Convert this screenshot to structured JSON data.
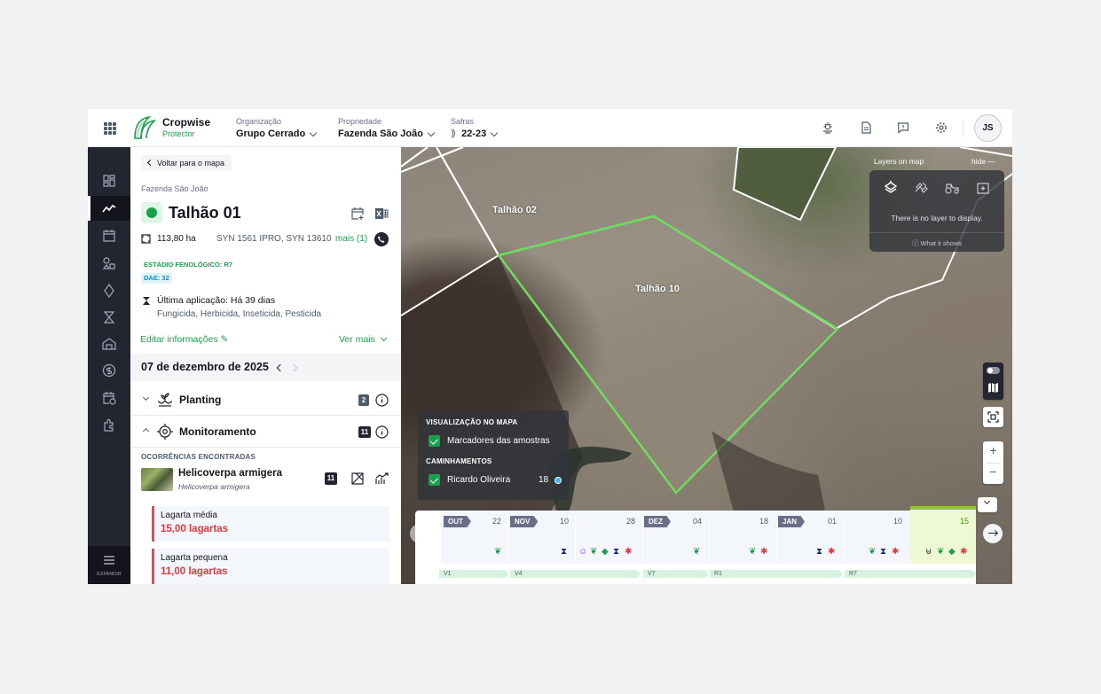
{
  "header": {
    "brand_name": "Cropwise",
    "brand_sub": "Protector",
    "org_label": "Organização",
    "org_value": "Grupo Cerrado",
    "prop_label": "Propriedade",
    "prop_value": "Fazenda São João",
    "safra_label": "Safras",
    "safra_value": "22-23",
    "avatar": "JS"
  },
  "nav": {
    "expand_label": "EXPANDIR"
  },
  "panel": {
    "back_label": "Voltar para o mapa",
    "farm": "Fazenda São João",
    "field_title": "Talhão 01",
    "area": "113,80 ha",
    "varieties": "SYN 1561 IPRO, SYN 13610",
    "more": "mais (1)",
    "stage_tag": "ESTÁDIO FENOLÓGICO: R7",
    "dae_tag": "DAE: 32",
    "last_app": "Última aplicação: Há 39 dias",
    "last_app_types": "Fungicida, Herbicida, Inseticida, Pesticida",
    "edit_label": "Editar informações",
    "see_more": "Ver mais",
    "date": "07 de dezembro de 2025",
    "sections": [
      {
        "title": "Planting",
        "count": "2"
      },
      {
        "title": "Monitoramento",
        "count": "11"
      }
    ],
    "occurrences_label": "OCORRÊNCIAS ENCONTRADAS",
    "pest": {
      "name": "Helicoverpa armigera",
      "scientific": "Helicoverpa armigera",
      "count": "11"
    },
    "cards": [
      {
        "label": "Lagarta média",
        "value": "15,00 lagartas"
      },
      {
        "label": "Lagarta pequena",
        "value": "11,00 lagartas"
      }
    ]
  },
  "map": {
    "fields": [
      "Talhão 02",
      "Talhão 10"
    ],
    "layers_title": "Layers on map",
    "layers_hide": "hide",
    "no_layer": "There is no layer to display.",
    "what_it_shows": "What it shows",
    "viz_title": "VISUALIZAÇÃO NO MAPA",
    "viz_item": "Marcadores das amostras",
    "walks_title": "CAMINHAMENTOS",
    "walker": "Ricardo Oliveira",
    "walker_count": "18",
    "zoom_in": "+",
    "zoom_out": "−"
  },
  "timeline": {
    "months": [
      "OUT",
      "NOV",
      "DEZ",
      "JAN"
    ],
    "days": [
      "22",
      "10",
      "28",
      "04",
      "18",
      "01",
      "10",
      "15"
    ],
    "stages": [
      "V1",
      "V4",
      "V7",
      "R1",
      "R7"
    ]
  },
  "colors": {
    "brand_green": "#19a04b",
    "field_outline": "#6fdc5f",
    "alert_red": "#e8383e",
    "rail_dark": "#232630"
  }
}
